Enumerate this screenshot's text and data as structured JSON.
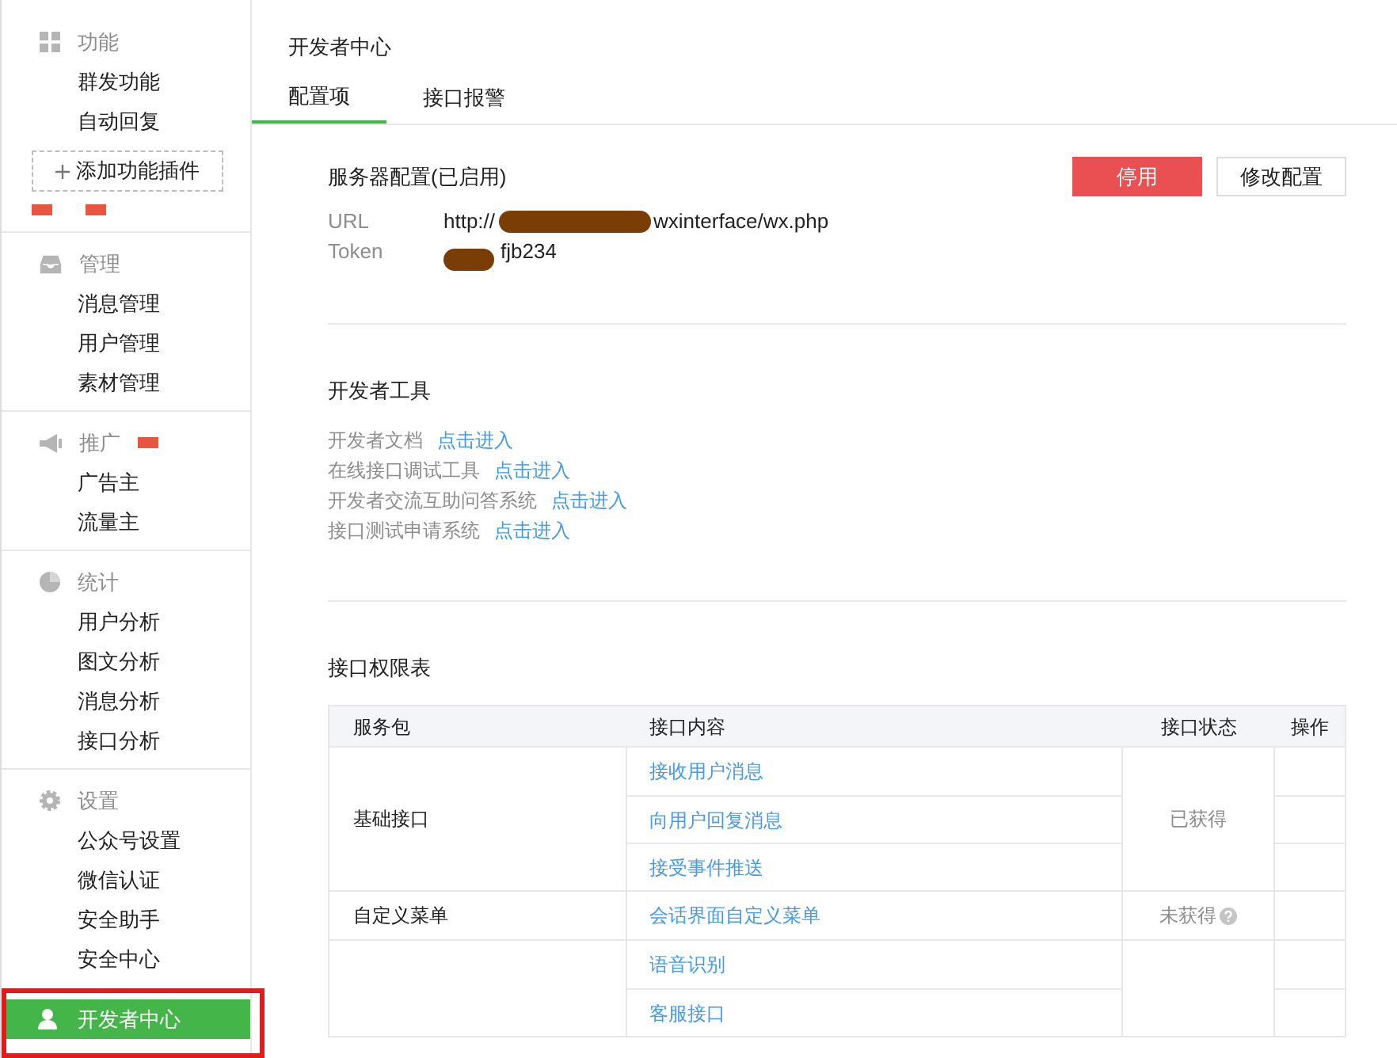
{
  "sidebar": {
    "groups": [
      {
        "title": "功能",
        "items": [
          {
            "label": "群发功能",
            "selected": false
          },
          {
            "label": "自动回复",
            "selected": false
          }
        ],
        "add_button": "添加功能插件"
      },
      {
        "title": "管理",
        "items": [
          {
            "label": "消息管理",
            "selected": false
          },
          {
            "label": "用户管理",
            "selected": false
          },
          {
            "label": "素材管理",
            "selected": false
          }
        ]
      },
      {
        "title": "推广",
        "items": [
          {
            "label": "广告主",
            "selected": false
          },
          {
            "label": "流量主",
            "selected": false
          }
        ]
      },
      {
        "title": "统计",
        "items": [
          {
            "label": "用户分析",
            "selected": false
          },
          {
            "label": "图文分析",
            "selected": false
          },
          {
            "label": "消息分析",
            "selected": false
          },
          {
            "label": "接口分析",
            "selected": false
          }
        ]
      },
      {
        "title": "设置",
        "items": [
          {
            "label": "公众号设置",
            "selected": false
          },
          {
            "label": "微信认证",
            "selected": false
          },
          {
            "label": "安全助手",
            "selected": false
          },
          {
            "label": "安全中心",
            "selected": false
          }
        ]
      }
    ],
    "active": {
      "label": "开发者中心",
      "selected": true
    }
  },
  "page_title": "开发者中心",
  "tabs": [
    {
      "label": "配置项",
      "selected": true
    },
    {
      "label": "接口报警",
      "selected": false
    }
  ],
  "server": {
    "title": "服务器配置(已启用)",
    "buttons": [
      {
        "label": "停用",
        "kind": "danger"
      },
      {
        "label": "修改配置",
        "kind": "default"
      }
    ],
    "fields": [
      {
        "label": "URL",
        "prefix": "http://",
        "value": "wxinterface/wx.php"
      },
      {
        "label": "Token",
        "value": "fjb234"
      }
    ]
  },
  "tools": {
    "title": "开发者工具",
    "items": [
      {
        "label": "开发者文档",
        "link": "点击进入"
      },
      {
        "label": "在线接口调试工具",
        "link": "点击进入"
      },
      {
        "label": "开发者交流互助问答系统",
        "link": "点击进入"
      },
      {
        "label": "接口测试申请系统",
        "link": "点击进入"
      }
    ]
  },
  "permissions": {
    "title": "接口权限表",
    "columns": [
      "服务包",
      "接口内容",
      "接口状态",
      "操作"
    ],
    "groups": [
      {
        "package": "基础接口",
        "items": [
          "接收用户消息",
          "向用户回复消息",
          "接受事件推送"
        ],
        "status": "已获得",
        "help": false
      },
      {
        "package": "自定义菜单",
        "items": [
          "会话界面自定义菜单"
        ],
        "status": "未获得",
        "help": true
      },
      {
        "items": [
          "语音识别",
          "客服接口"
        ],
        "help": false
      }
    ]
  }
}
